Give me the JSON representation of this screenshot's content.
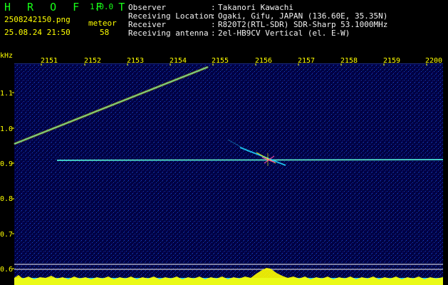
{
  "app": {
    "name": "H R O F F T",
    "version": "1.0.0"
  },
  "capture": {
    "filename": "2508242150.png",
    "datetime": "25.08.24 21:50",
    "mode_label": "meteor",
    "count": "58"
  },
  "station": {
    "labels": [
      "Observer",
      "Receiving Location",
      "Receiver",
      "Receiving antenna"
    ],
    "separator": ":",
    "values": [
      "Takanori Kawachi",
      "Ogaki, Gifu, JAPAN (136.60E, 35.35N)",
      "R820T2(RTL-SDR) SDR-Sharp 53.1000MHz",
      "2el-HB9CV Vertical (el. E-W)"
    ]
  },
  "axes": {
    "x_unit": "kHz",
    "x_ticks": [
      "2151",
      "2152",
      "2153",
      "2154",
      "2155",
      "2156",
      "2157",
      "2158",
      "2159",
      "2200"
    ],
    "y_ticks": [
      "1.1",
      "1.0",
      "0.9",
      "0.8",
      "0.7",
      "0.6"
    ]
  },
  "colors": {
    "background": "#000044",
    "header_green": "#18ff18",
    "header_white": "#f3f3f3",
    "axis_yellow": "#ffff00",
    "signal_cyan": "#22d8ff",
    "signal_yellow": "#ffff00"
  }
}
